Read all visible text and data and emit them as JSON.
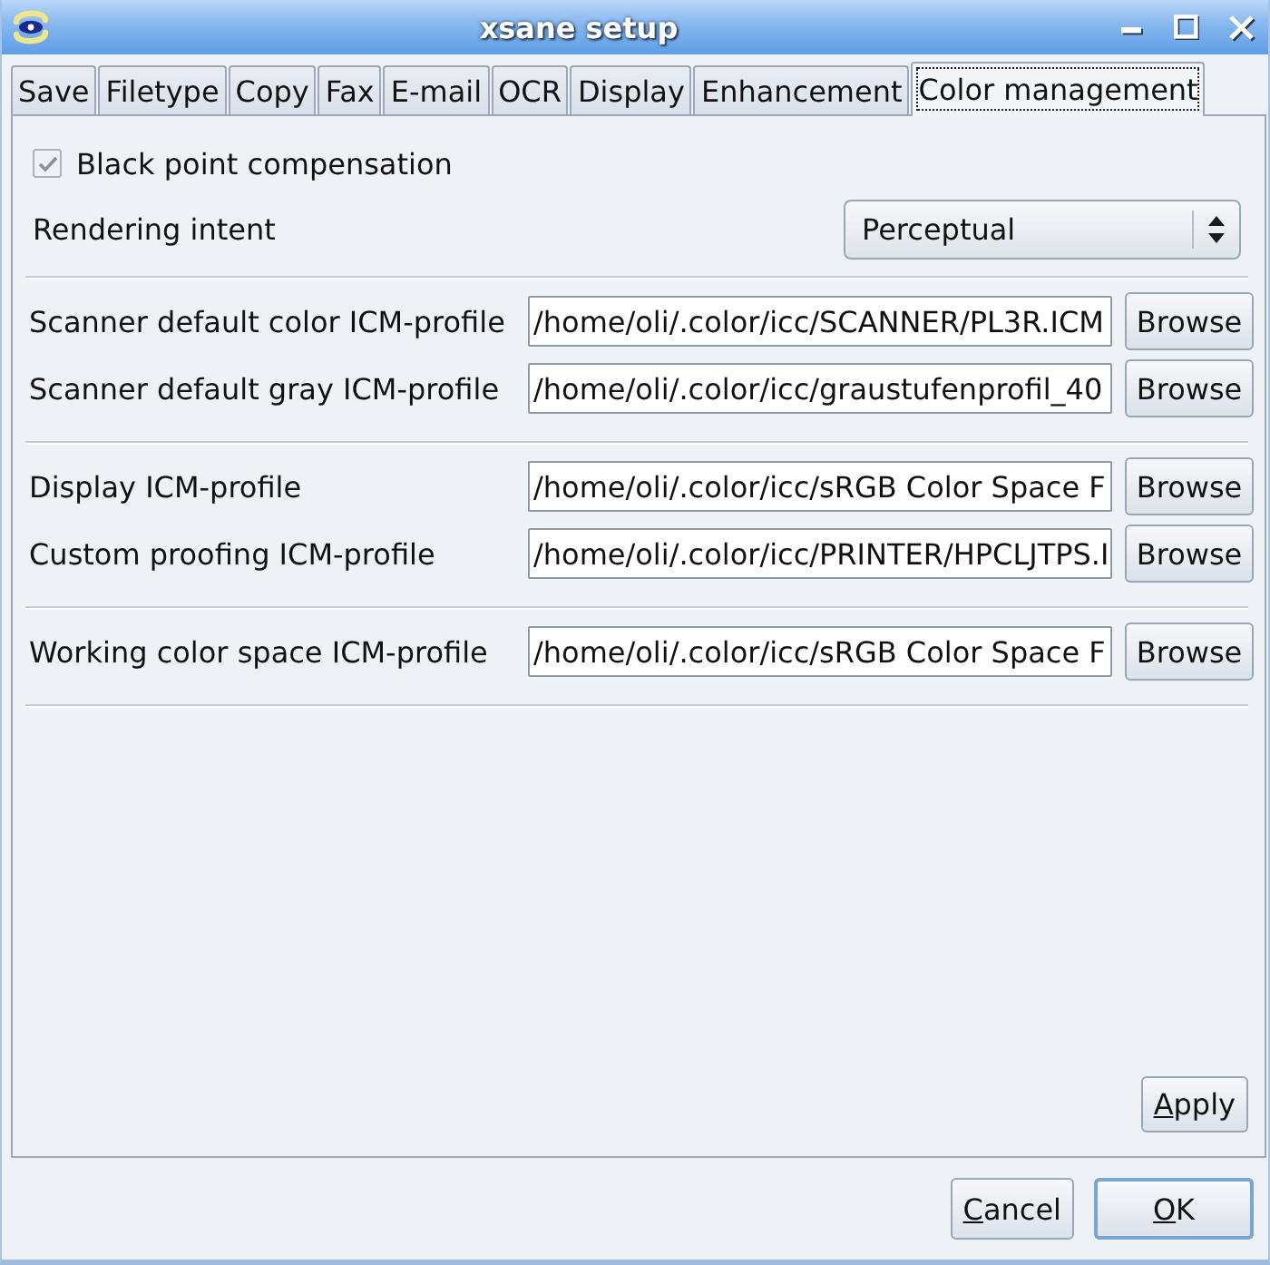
{
  "window": {
    "title": "xsane setup"
  },
  "tabs": [
    {
      "label": "Save",
      "selected": false
    },
    {
      "label": "Filetype",
      "selected": false
    },
    {
      "label": "Copy",
      "selected": false
    },
    {
      "label": "Fax",
      "selected": false
    },
    {
      "label": "E-mail",
      "selected": false
    },
    {
      "label": "OCR",
      "selected": false
    },
    {
      "label": "Display",
      "selected": false
    },
    {
      "label": "Enhancement",
      "selected": false
    },
    {
      "label": "Color management",
      "selected": true
    }
  ],
  "black_point_compensation": {
    "label": "Black point compensation",
    "checked": true
  },
  "rendering_intent": {
    "label": "Rendering intent",
    "value": "Perceptual"
  },
  "profile_sections": [
    {
      "rows": [
        {
          "label": "Scanner default color ICM-profile",
          "path": "/home/oli/.color/icc/SCANNER/PL3R.ICM",
          "button": "Browse"
        },
        {
          "label": "Scanner default gray ICM-profile",
          "path": "/home/oli/.color/icc/graustufenprofil_40",
          "button": "Browse"
        }
      ]
    },
    {
      "rows": [
        {
          "label": "Display ICM-profile",
          "path": "/home/oli/.color/icc/sRGB Color Space F",
          "button": "Browse"
        },
        {
          "label": "Custom proofing ICM-profile",
          "path": "/home/oli/.color/icc/PRINTER/HPCLJTPS.I",
          "button": "Browse"
        }
      ]
    },
    {
      "rows": [
        {
          "label": "Working color space ICM-profile",
          "path": "/home/oli/.color/icc/sRGB Color Space F",
          "button": "Browse"
        }
      ]
    }
  ],
  "apply_button": {
    "label": "Apply",
    "mnemonic": true
  },
  "dialog_buttons": [
    {
      "label": "Cancel",
      "mnemonic": true,
      "default": false
    },
    {
      "label": "OK",
      "mnemonic": true,
      "default": true
    }
  ]
}
